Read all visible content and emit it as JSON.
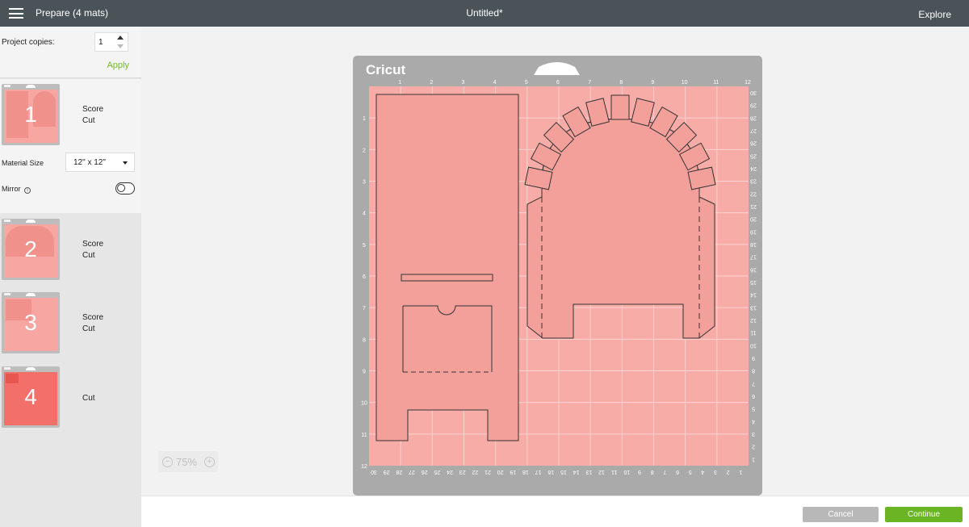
{
  "header": {
    "title": "Prepare (4 mats)",
    "project_name": "Untitled*",
    "right_link": "Explore",
    "menu_icon": "hamburger-menu-icon"
  },
  "sidebar": {
    "copies_label": "Project copies:",
    "copies_value": "1",
    "apply_label": "Apply",
    "material_size_label": "Material Size",
    "material_size_value": "12\" x 12\"",
    "mirror_label": "Mirror",
    "mirror_on": false,
    "mats": [
      {
        "number": "1",
        "ops": [
          "Score",
          "Cut"
        ],
        "selected": true
      },
      {
        "number": "2",
        "ops": [
          "Score",
          "Cut"
        ],
        "selected": false
      },
      {
        "number": "3",
        "ops": [
          "Score",
          "Cut"
        ],
        "selected": false
      },
      {
        "number": "4",
        "ops": [
          "Cut"
        ],
        "selected": false
      }
    ]
  },
  "mat_preview": {
    "logo": "Cricut",
    "top_ruler": [
      "1",
      "2",
      "3",
      "4",
      "5",
      "6",
      "7",
      "8",
      "9",
      "10",
      "11",
      "12"
    ],
    "left_ruler": [
      "1",
      "2",
      "3",
      "4",
      "5",
      "6",
      "7",
      "8",
      "9",
      "10",
      "11",
      "12"
    ],
    "right_ruler": [
      "30",
      "29",
      "28",
      "27",
      "26",
      "25",
      "24",
      "23",
      "22",
      "21",
      "20",
      "19",
      "18",
      "17",
      "16",
      "15",
      "14",
      "13",
      "12",
      "11",
      "10",
      "9",
      "8",
      "7",
      "6",
      "5",
      "4",
      "3",
      "2",
      "1"
    ],
    "bottom_ruler": [
      "30",
      "29",
      "28",
      "27",
      "26",
      "25",
      "24",
      "23",
      "22",
      "21",
      "20",
      "19",
      "18",
      "17",
      "16",
      "15",
      "14",
      "13",
      "12",
      "11",
      "10",
      "9",
      "8",
      "7",
      "6",
      "5",
      "4",
      "3",
      "2",
      "1"
    ],
    "mat_color": "#f7aca7",
    "frame_color": "#aaaaaa"
  },
  "zoom": {
    "value": "75%"
  },
  "footer": {
    "cancel_label": "Cancel",
    "continue_label": "Continue"
  },
  "colors": {
    "accent_green": "#6bb424",
    "header_bg": "#4a5458"
  }
}
